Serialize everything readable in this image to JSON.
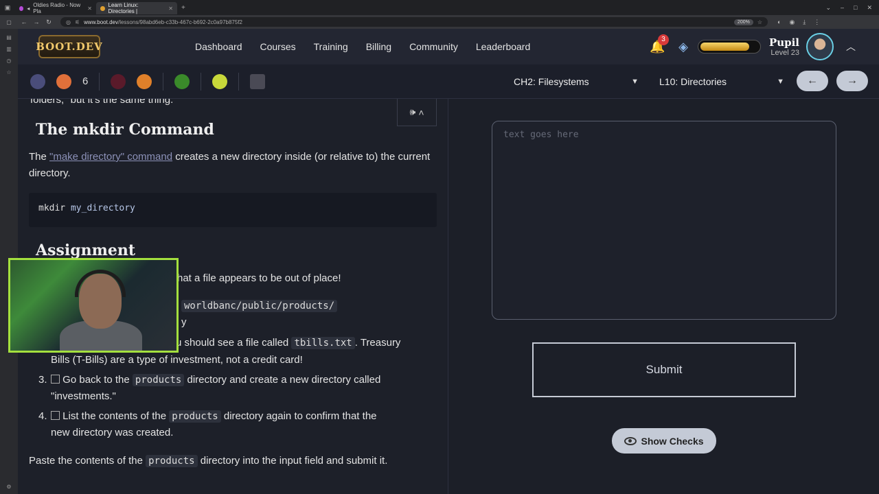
{
  "browser": {
    "tabs": [
      {
        "title": "Oldies Radio - Now Pla",
        "active": false
      },
      {
        "title": "Learn Linux: Directories |",
        "active": true
      }
    ],
    "url_host": "www.boot.dev",
    "url_path": "/lessons/98abd6eb-c33b-467c-b692-2c0a97b875f2",
    "zoom": "200%"
  },
  "header": {
    "logo": "BOOT.DEV",
    "nav": [
      "Dashboard",
      "Courses",
      "Training",
      "Billing",
      "Community",
      "Leaderboard"
    ],
    "notifications": "3",
    "xp_fill_fraction": 0.85,
    "username": "Pupil",
    "level": "Level 23"
  },
  "subheader": {
    "item_count": "6",
    "chapter": "CH2: Filesystems",
    "lesson": "L10: Directories"
  },
  "lesson": {
    "top_cut_text": "folders,\" but it's the same thing.",
    "heading": "The mkdir Command",
    "p1_before": "The ",
    "p1_link": "\"make directory\" command",
    "p1_after": " creates a new directory inside (or relative to) the current directory.",
    "code_cmd": "mkdir",
    "code_arg": "my_directory",
    "assignment_heading": "Assignment",
    "line1": "hat a file appears to be out of place!",
    "line2_code": "worldbanc/public/products/",
    "line2_tail": "y",
    "line3_a": "u should see a file called ",
    "line3_code": "tbills.txt",
    "line3_b": ". Treasury",
    "line3_cont": "Bills (T-Bills) are a type of investment, not a credit card!",
    "step3_num": "3.",
    "step3_a": "Go back to the ",
    "step3_code": "products",
    "step3_b": " directory and create a new directory called",
    "step3_cont": "\"investments.\"",
    "step4_num": "4.",
    "step4_a": "List the contents of the ",
    "step4_code": "products",
    "step4_b": " directory again to confirm that the",
    "step4_cont": "new directory was created.",
    "final_a": "Paste the contents of the ",
    "final_code": "products",
    "final_b": " directory into the input field and submit it."
  },
  "answer": {
    "placeholder": "text goes here",
    "submit_label": "Submit",
    "show_checks_label": "Show Checks"
  }
}
